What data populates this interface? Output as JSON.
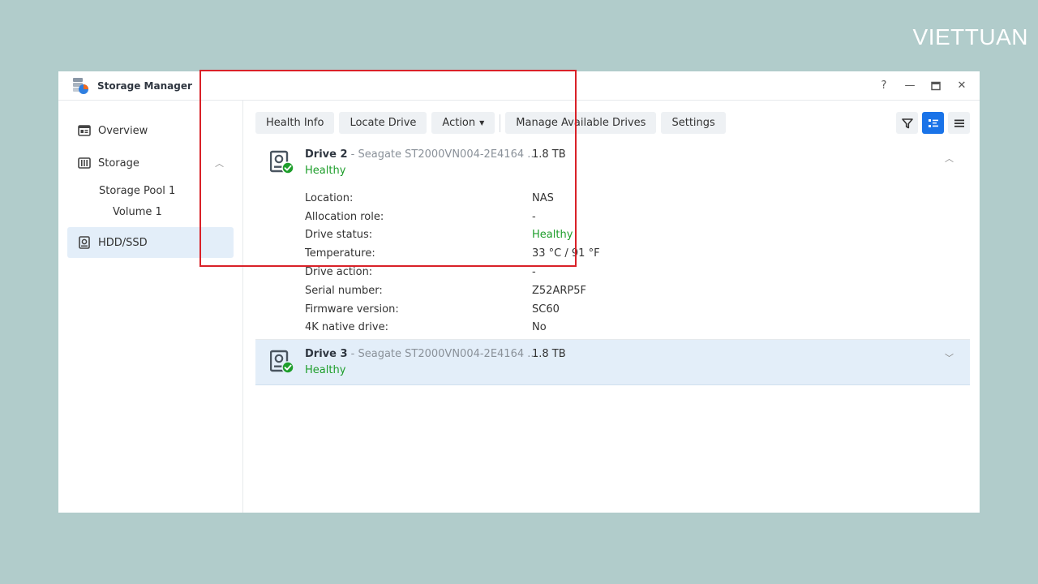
{
  "brand": "VIETTUAN",
  "window": {
    "title": "Storage Manager",
    "controls": [
      "?",
      "—",
      "□",
      "✕"
    ]
  },
  "sidebar": {
    "items": [
      {
        "label": "Overview",
        "icon": "overview-icon"
      },
      {
        "label": "Storage",
        "icon": "storage-icon",
        "expanded": true,
        "children": [
          {
            "label": "Storage Pool 1",
            "children": [
              {
                "label": "Volume 1"
              }
            ]
          }
        ]
      },
      {
        "label": "HDD/SSD",
        "icon": "hdd-icon",
        "active": true
      }
    ]
  },
  "toolbar": {
    "buttons": [
      "Health Info",
      "Locate Drive",
      "Action",
      "Manage Available Drives",
      "Settings"
    ],
    "view_modes": [
      "filter-icon",
      "list-detail-icon",
      "list-icon"
    ],
    "active_view": "list-detail-icon"
  },
  "drives": [
    {
      "name": "Drive 2",
      "model": " - Seagate ST2000VN004-2E4164 ...",
      "size": "1.8 TB",
      "status": "Healthy",
      "expanded": true,
      "details": [
        {
          "label": "Location:",
          "value": "NAS"
        },
        {
          "label": "Allocation role:",
          "value": "-"
        },
        {
          "label": "Drive status:",
          "value": "Healthy"
        },
        {
          "label": "Temperature:",
          "value": "33 °C / 91 °F"
        },
        {
          "label": "Drive action:",
          "value": "-"
        },
        {
          "label": "Serial number:",
          "value": "Z52ARP5F"
        },
        {
          "label": "Firmware version:",
          "value": "SC60"
        },
        {
          "label": "4K native drive:",
          "value": "No"
        }
      ]
    },
    {
      "name": "Drive 3",
      "model": " - Seagate ST2000VN004-2E4164 ...",
      "size": "1.8 TB",
      "status": "Healthy",
      "expanded": false
    }
  ],
  "colors": {
    "background": "#b1cccb",
    "accent": "#1a73e8",
    "healthy": "#1e9e2b",
    "highlight": "#d92128",
    "selected_row": "#e3eef9"
  }
}
